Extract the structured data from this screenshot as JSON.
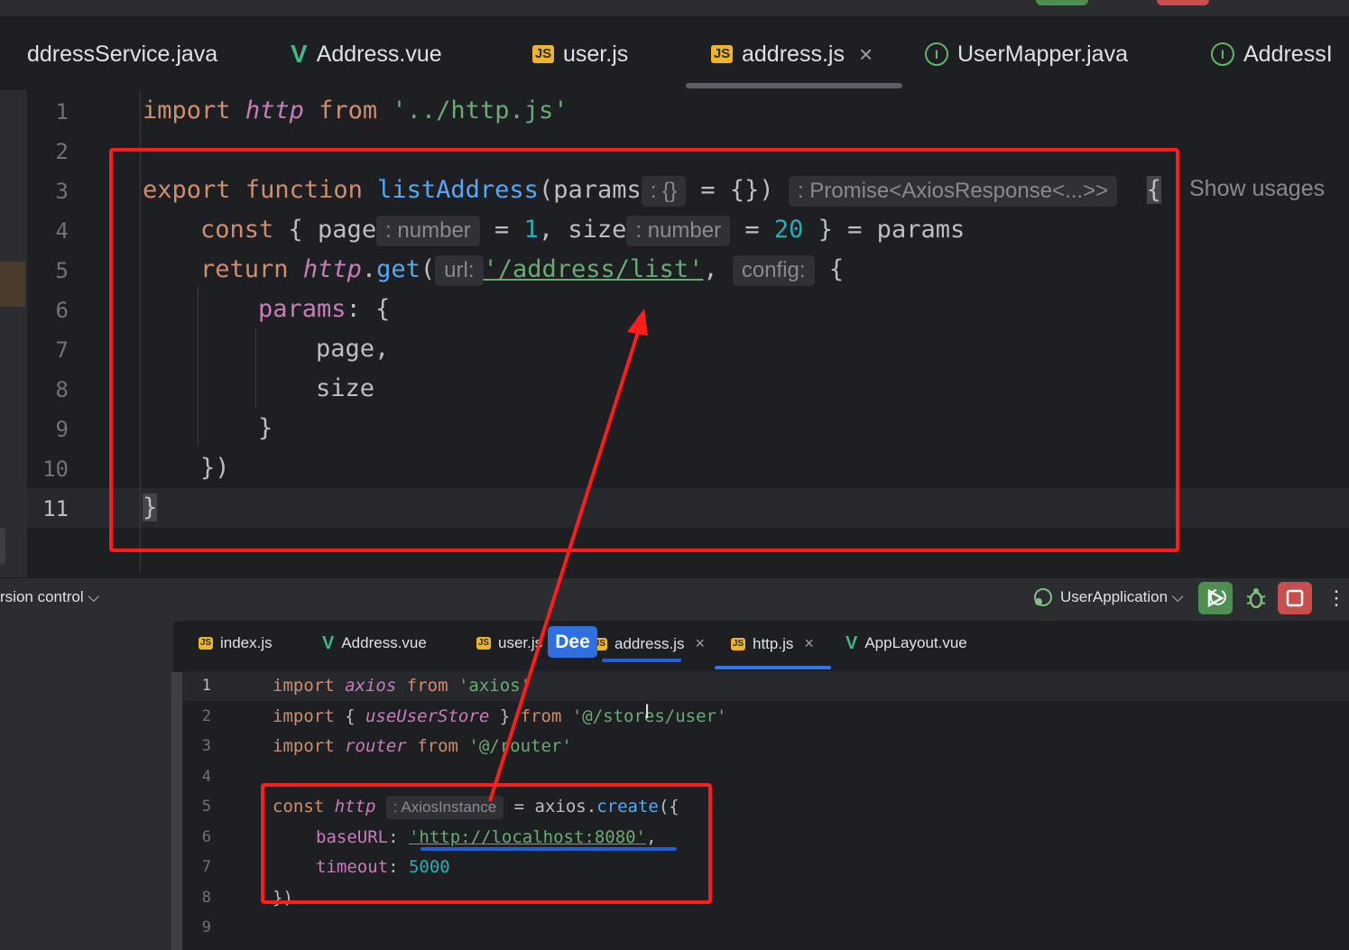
{
  "top_tabs": [
    {
      "label": "ddressService.java",
      "icon": "none"
    },
    {
      "label": "Address.vue",
      "icon": "vue-icon"
    },
    {
      "label": "user.js",
      "icon": "js-icon"
    },
    {
      "label": "address.js",
      "icon": "js-icon",
      "active": true
    },
    {
      "label": "UserMapper.java",
      "icon": "interface-icon"
    },
    {
      "label": "AddressI",
      "icon": "interface-icon"
    }
  ],
  "icons": {
    "js": "JS",
    "vue": "V",
    "interface": "I",
    "close": "×"
  },
  "top_line_numbers": [
    "1",
    "2",
    "3",
    "4",
    "5",
    "6",
    "7",
    "8",
    "9",
    "10",
    "11"
  ],
  "top_code": {
    "l1": {
      "import": "import",
      "name": "http",
      "from": "from",
      "path": "'../http.js'"
    },
    "l3": {
      "export": "export",
      "function": "function",
      "name": "listAddress",
      "open": "(params",
      "hint_params": ": {}",
      "default": " = {})",
      "hint_return": ": Promise<AxiosResponse<...>>",
      "brace": "{"
    },
    "l4": {
      "const": "const",
      "open": " { page",
      "hint_page": ": number",
      "eq1": " = ",
      "one": "1",
      "comma_size": ", size",
      "hint_size": ": number",
      "eq2": " = ",
      "twenty": "20",
      "rest": " } = params"
    },
    "l5": {
      "return": "return",
      "http": "http",
      "dot": ".",
      "get": "get",
      "paren": "(",
      "hint_url": "url:",
      "url": "'/address/list'",
      "comma": ", ",
      "hint_config": "config:",
      "brace": " {"
    },
    "l6": {
      "params": "params",
      "rest": ": {"
    },
    "l7": "page,",
    "l8": "size",
    "l9": "}",
    "l10": "})",
    "l11": "}"
  },
  "show_usages": "Show usages",
  "panel": {
    "version_control": "rsion control ⌵",
    "run_config": "UserApplication ⌵",
    "more": "⋮"
  },
  "bottom_tabs": [
    {
      "label": "index.js",
      "icon": "js-icon"
    },
    {
      "label": "Address.vue",
      "icon": "vue-icon"
    },
    {
      "label": "user.js",
      "icon": "js-icon"
    },
    {
      "label": "address.js",
      "icon": "js-icon"
    },
    {
      "label": "http.js",
      "icon": "js-icon",
      "active": true
    },
    {
      "label": "AppLayout.vue",
      "icon": "vue-icon"
    }
  ],
  "dee_badge": "Dee",
  "bottom_line_numbers": [
    "1",
    "2",
    "3",
    "4",
    "5",
    "6",
    "7",
    "8",
    "9"
  ],
  "bottom_code": {
    "l1": {
      "import": "import",
      "name": "axios",
      "from": "from",
      "path": "'axios'"
    },
    "l2": {
      "import": "import",
      "open": "{ ",
      "name": "useUserStore",
      "close": " }",
      "from": "from",
      "path": "'@/stores/user'"
    },
    "l3": {
      "import": "import",
      "name": "router",
      "from": "from",
      "path": "'@/router'"
    },
    "l5": {
      "const": "const",
      "name": "http",
      "hint": ": AxiosInstance",
      "eq": " = ",
      "axios": "axios",
      "dot": ".",
      "create": "create",
      "open": "({"
    },
    "l6": {
      "key": "baseURL",
      "colon": ": ",
      "value": "'http://localhost:8080'",
      "comma": ","
    },
    "l7": {
      "key": "timeout",
      "colon": ": ",
      "value": "5000"
    },
    "l8": "})"
  },
  "colors": {
    "annotation_red": "#ff1c1c",
    "annotation_blue": "#1f5fd6",
    "run_green": "#4e8f51",
    "stop_red": "#c94f4f"
  }
}
